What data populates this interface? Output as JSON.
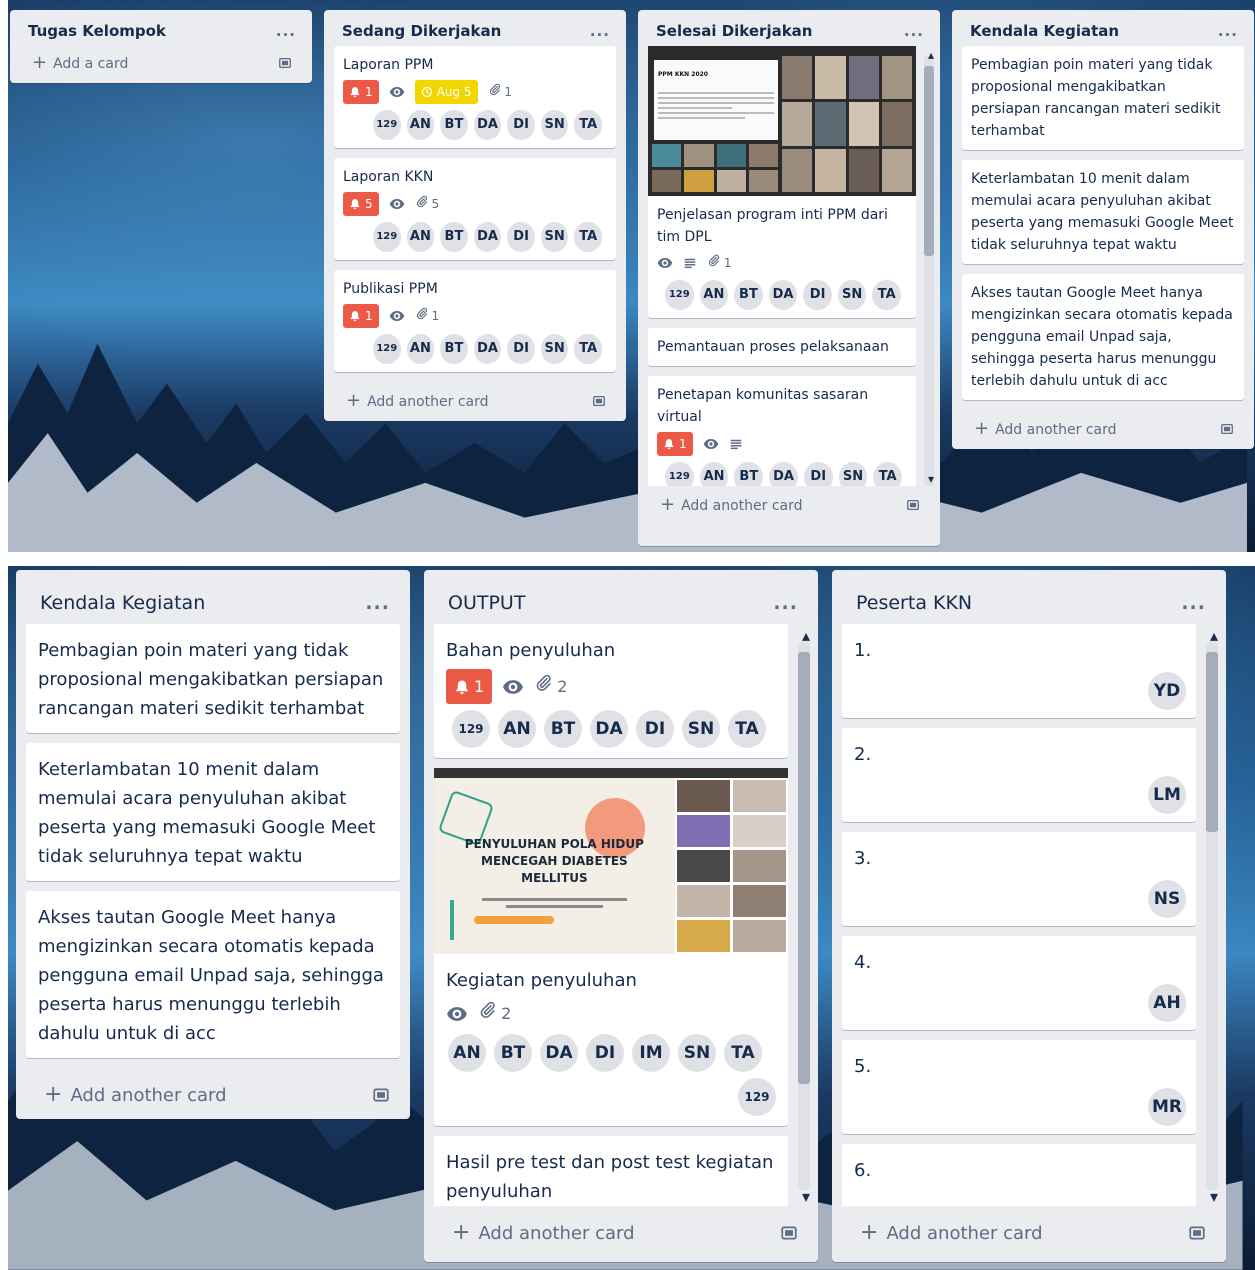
{
  "top": {
    "lists": [
      {
        "title": "Tugas Kelompok",
        "menu": "...",
        "add_label": "Add a card",
        "cards": []
      },
      {
        "title": "Sedang Dikerjakan",
        "menu": "...",
        "add_label": "Add another card",
        "cards": [
          {
            "title": "Laporan PPM",
            "notif": "1",
            "due": "Aug 5",
            "attachments": "1",
            "members": [
              "129",
              "AN",
              "BT",
              "DA",
              "DI",
              "SN",
              "TA"
            ]
          },
          {
            "title": "Laporan KKN",
            "notif": "5",
            "attachments": "5",
            "members": [
              "129",
              "AN",
              "BT",
              "DA",
              "DI",
              "SN",
              "TA"
            ]
          },
          {
            "title": "Publikasi PPM",
            "notif": "1",
            "attachments": "1",
            "members": [
              "129",
              "AN",
              "BT",
              "DA",
              "DI",
              "SN",
              "TA"
            ]
          }
        ]
      },
      {
        "title": "Selesai Dikerjakan",
        "menu": "...",
        "add_label": "Add another card",
        "cards": [
          {
            "title": "Penjelasan program inti PPM dari tim DPL",
            "cover_text": "PPM KKN 2020",
            "attachments": "1",
            "members": [
              "129",
              "AN",
              "BT",
              "DA",
              "DI",
              "SN",
              "TA"
            ]
          },
          {
            "title": "Pemantauan proses pelaksanaan"
          },
          {
            "title": "Penetapan komunitas sasaran virtual",
            "notif": "1",
            "members": [
              "129",
              "AN",
              "BT",
              "DA",
              "DI",
              "SN",
              "TA"
            ]
          }
        ]
      },
      {
        "title": "Kendala Kegiatan",
        "menu": "...",
        "add_label": "Add another card",
        "cards": [
          {
            "title": "Pembagian poin materi yang tidak proposional mengakibatkan persiapan rancangan materi sedikit terhambat"
          },
          {
            "title": "Keterlambatan 10 menit dalam memulai acara penyuluhan akibat peserta yang memasuki Google Meet tidak seluruhnya tepat waktu"
          },
          {
            "title": "Akses tautan Google Meet hanya mengizinkan secara otomatis kepada pengguna email Unpad saja, sehingga peserta harus menunggu terlebih dahulu untuk di acc"
          }
        ]
      }
    ]
  },
  "bottom": {
    "lists": [
      {
        "title": "Kendala Kegiatan",
        "menu": "...",
        "add_label": "Add another card",
        "cards": [
          {
            "title": "Pembagian poin materi yang tidak proposional mengakibatkan persiapan rancangan materi sedikit terhambat"
          },
          {
            "title": "Keterlambatan 10 menit dalam memulai acara penyuluhan akibat peserta yang memasuki Google Meet tidak seluruhnya tepat waktu"
          },
          {
            "title": "Akses tautan Google Meet hanya mengizinkan secara otomatis kepada pengguna email Unpad saja, sehingga peserta harus menunggu terlebih dahulu untuk di acc"
          }
        ]
      },
      {
        "title": "OUTPUT",
        "menu": "...",
        "add_label": "Add another card",
        "cards": [
          {
            "title": "Bahan penyuluhan",
            "notif": "1",
            "attachments": "2",
            "members": [
              "129",
              "AN",
              "BT",
              "DA",
              "DI",
              "SN",
              "TA"
            ]
          },
          {
            "title": "Kegiatan penyuluhan",
            "cover_title_lines": [
              "PENYULUHAN POLA HIDUP",
              "MENCEGAH DIABETES",
              "MELLITUS"
            ],
            "attachments": "2",
            "members": [
              "AN",
              "BT",
              "DA",
              "DI",
              "IM",
              "SN",
              "TA"
            ],
            "extra_member": "129"
          },
          {
            "title": "Hasil pre test dan post test kegiatan penyuluhan"
          }
        ]
      },
      {
        "title": "Peserta KKN",
        "menu": "...",
        "add_label": "Add another card",
        "cards": [
          {
            "title": "1.",
            "member": "YD"
          },
          {
            "title": "2.",
            "member": "LM"
          },
          {
            "title": "3.",
            "member": "NS"
          },
          {
            "title": "4.",
            "member": "AH"
          },
          {
            "title": "5.",
            "member": "MR"
          },
          {
            "title": "6.",
            "member": ""
          }
        ]
      }
    ]
  },
  "icons": {
    "plus": "+",
    "bell": "bell-icon",
    "eye": "eye-icon",
    "clip": "paperclip-icon",
    "clock": "clock-icon",
    "desc": "description-icon",
    "card_template": "card-template-icon"
  },
  "colors": {
    "red_badge": "#eb5a46",
    "yellow_badge": "#f2d600",
    "list_bg": "#ebecf0"
  }
}
